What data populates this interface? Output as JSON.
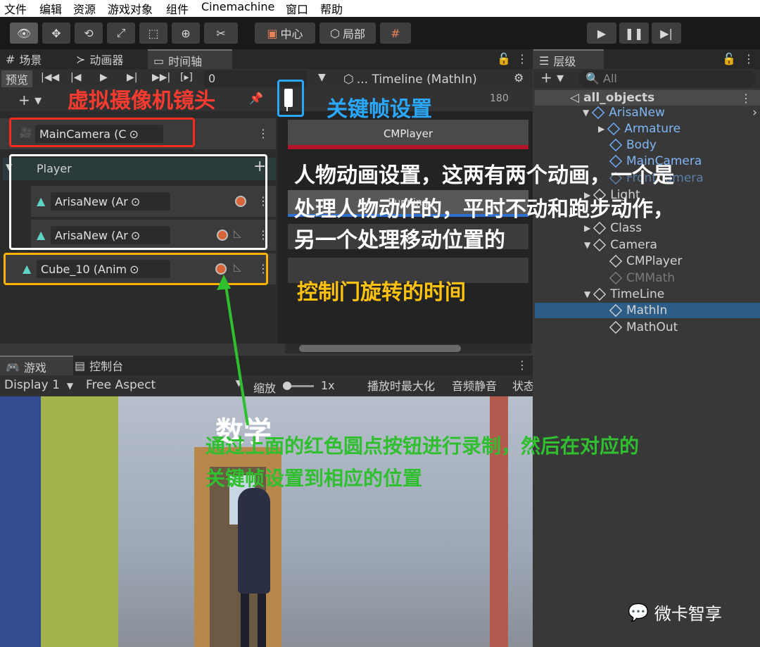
{
  "menubar": [
    "文件",
    "编辑",
    "资源",
    "游戏对象",
    "组件",
    "Cinemachine",
    "窗口",
    "帮助"
  ],
  "toolbar": {
    "center_label": "中心",
    "local_label": "局部"
  },
  "timeline_panel": {
    "tabs": [
      "场景",
      "动画器",
      "时间轴"
    ],
    "preview_label": "预览",
    "frame_value": "0",
    "asset_label": "... Timeline (MathIn)",
    "ruler_mark": "180",
    "clip_cmplayer": "CMPlayer",
    "clip_running": "Running",
    "tracks": {
      "camera": "MainCamera (C",
      "group": "Player",
      "arisa1": "ArisaNew (Ar",
      "arisa2": "ArisaNew (Ar",
      "cube": "Cube_10 (Anim"
    }
  },
  "game_panel": {
    "tabs": [
      "游戏",
      "控制台"
    ],
    "display": "Display 1",
    "aspect": "Free Aspect",
    "zoom_label": "缩放",
    "zoom_value": "1x",
    "maximize": "播放时最大化",
    "mute": "音频静音",
    "stats": "状态",
    "scene_sign": "数学"
  },
  "hierarchy": {
    "tab": "层级",
    "search_placeholder": "All",
    "items": [
      {
        "label": "all_objects"
      },
      {
        "label": "ArisaNew"
      },
      {
        "label": "Armature"
      },
      {
        "label": "Body"
      },
      {
        "label": "MainCamera"
      },
      {
        "label": "FrontCamera"
      },
      {
        "label": "Light"
      },
      {
        "label": "Class"
      },
      {
        "label": "Camera"
      },
      {
        "label": "CMPlayer"
      },
      {
        "label": "CMMath"
      },
      {
        "label": "TimeLine"
      },
      {
        "label": "MathIn"
      },
      {
        "label": "MathOut"
      }
    ]
  },
  "annotations": {
    "camera_shot": "虚拟摄像机镜头",
    "keyframe": "关键帧设置",
    "anim_line1": "人物动画设置，这两有两个动画，一个是",
    "anim_line2": "处理人物动作的，平时不动和跑步动作，",
    "anim_line3": "另一个处理移动位置的",
    "door": "控制门旋转的时间",
    "record_line1": "通过上面的红色圆点按钮进行录制，然后在对应的",
    "record_line2": "关键帧设置到相应的位置"
  },
  "watermark": "微卡智享",
  "colors": {
    "red": "#ff3b30",
    "blue": "#2aa7ff",
    "yellow": "#ffc20e",
    "green": "#2fbf2f",
    "selection": "#2c5d87"
  }
}
